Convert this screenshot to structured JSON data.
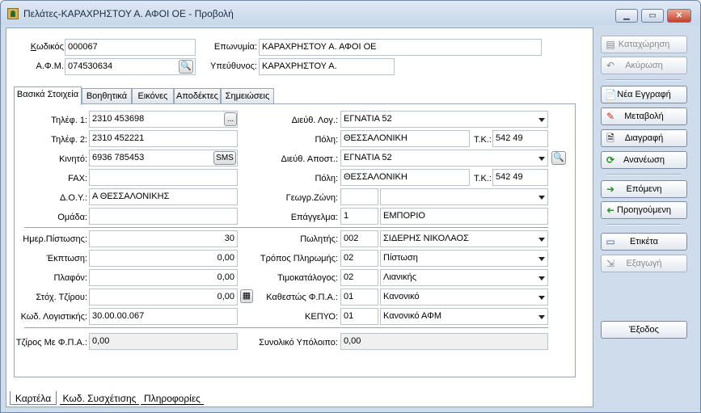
{
  "window": {
    "title": "Πελάτες-ΚΑΡΑΧΡΗΣΤΟΥ Α. ΑΦΟΙ ΟΕ  -  Προβολή",
    "minimize_glyph": "▁",
    "maximize_glyph": "▭",
    "close_glyph": "✕"
  },
  "header": {
    "code_label_u": "Κ",
    "code_label_rest": "ωδικός:",
    "code_value": "000067",
    "afm_label": "Α.Φ.Μ.:",
    "afm_value": "074530634",
    "name_label": "Επωνυμία:",
    "name_value": "ΚΑΡΑΧΡΗΣΤΟΥ Α. ΑΦΟΙ ΟΕ",
    "responsible_label": "Υπεύθυνος:",
    "responsible_value": "ΚΑΡΑΧΡΗΣΤΟΥ Α."
  },
  "tabs": [
    "Βασικά Στοιχεία",
    "Βοηθητικά",
    "Εικόνες",
    "Αποδέκτες",
    "Σημειώσεις"
  ],
  "form": {
    "phone1_label": "Τηλέφ. 1:",
    "phone1": "2310 453698",
    "phone2_label": "Τηλέφ. 2:",
    "phone2": "2310 452221",
    "mobile_label": "Κινητό:",
    "mobile": "6936 785453",
    "sms_label": "SMS",
    "ellipsis_label": "...",
    "fax_label": "FAX:",
    "fax": "",
    "doy_label": "Δ.Ο.Υ.:",
    "doy": "Α ΘΕΣΣΑΛΟΝΙΚΗΣ",
    "group_label": "Ομάδα:",
    "group": "",
    "address_label": "Διεύθ. Λογ.:",
    "address": "ΕΓΝΑΤΙΑ 52",
    "city_label": "Πόλη:",
    "city": "ΘΕΣΣΑΛΟΝΙΚΗ",
    "zip_label": "Τ.Κ.:",
    "zip": "542 49",
    "ship_address_label": "Διεύθ. Αποστ.:",
    "ship_address": "ΕΓΝΑΤΙΑ 52",
    "ship_city_label": "Πόλη:",
    "ship_city": "ΘΕΣΣΑΛΟΝΙΚΗ",
    "ship_zip_label": "Τ.Κ.:",
    "ship_zip": "542 49",
    "geo_zone_label": "Γεωγρ.Ζώνη:",
    "geo_zone_code": "",
    "geo_zone_name": "",
    "profession_label": "Επάγγελμα:",
    "profession_code": "1",
    "profession_name": "ΕΜΠΟΡΙΟ",
    "credit_days_label": "Ημερ.Πίστωσης:",
    "credit_days": "30",
    "discount_label": "Έκπτωση:",
    "discount": "0,00",
    "ceiling_label": "Πλαφόν:",
    "ceiling": "0,00",
    "target_turnover_label": "Στόχ. Τζίρου:",
    "target_turnover": "0,00",
    "account_code_label": "Κωδ. Λογιστικής:",
    "account_code": "30.00.00.067",
    "salesman_label": "Πωλητής:",
    "salesman_code": "002",
    "salesman_name": "ΣΙΔΕΡΗΣ ΝΙΚΟΛΑΟΣ",
    "payment_label": "Τρόπος Πληρωμής:",
    "payment_code": "02",
    "payment_name": "Πίστωση",
    "pricelist_label": "Τιμοκατάλογος:",
    "pricelist_code": "02",
    "pricelist_name": "Λιανικής",
    "vat_status_label": "Καθεστώς Φ.Π.Α.:",
    "vat_status_code": "01",
    "vat_status_name": "Κανονικό",
    "kepyo_label": "ΚΕΠΥΟ:",
    "kepyo_code": "01",
    "kepyo_name": "Κανονικό ΑΦΜ",
    "turnover_vat_label": "Τζίρος Με Φ.Π.Α.:",
    "turnover_vat": "0,00",
    "balance_label": "Συνολικό Υπόλοιπο:",
    "balance": "0,00"
  },
  "sidebar": {
    "save": "Καταχώρηση",
    "cancel": "Ακύρωση",
    "new": "Νέα Εγγραφή",
    "edit": "Μεταβολή",
    "delete": "Διαγραφή",
    "refresh": "Ανανέωση",
    "next": "Επόμενη",
    "previous": "Προηγούμενη",
    "label": "Ετικέτα",
    "export": "Εξαγωγή",
    "exit": "Έξοδος"
  },
  "bottom_tabs": [
    "Καρτέλα",
    "Κωδ. Συσχέτισης",
    "Πληροφορίες"
  ],
  "icons": {
    "search": "🔍",
    "calendar": "▦",
    "new": "📄",
    "edit": "✎",
    "delete": "🗎",
    "refresh": "⟳",
    "next": "➜",
    "previous": "➜",
    "label": "▭",
    "export": "⇲",
    "cancel": "↶",
    "save": "▤"
  },
  "colors": {
    "green_arrow": "#2e8b2e",
    "window_bg": "#cfdcec"
  }
}
